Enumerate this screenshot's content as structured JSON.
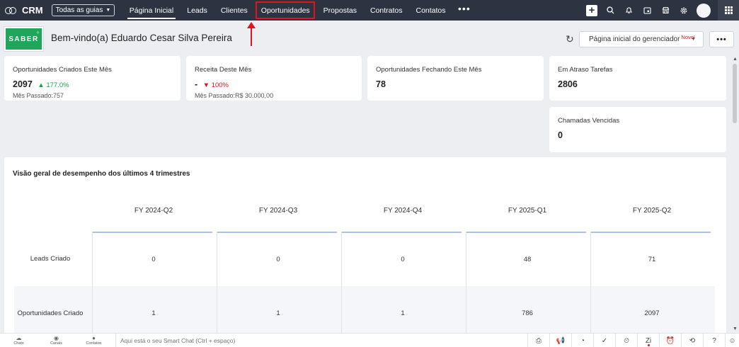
{
  "topbar": {
    "brand": "CRM",
    "scope_label": "Todas as guias",
    "nav": [
      "Página Inicial",
      "Leads",
      "Clientes",
      "Oportunidades",
      "Propostas",
      "Contratos",
      "Contatos"
    ],
    "active_nav": "Página Inicial",
    "highlighted_nav": "Oportunidades",
    "more_label": "•••",
    "icons": [
      "plus-icon",
      "search-icon",
      "bell-icon",
      "calendar-icon",
      "store-icon",
      "gear-icon",
      "avatar",
      "apps-grid-icon"
    ]
  },
  "header": {
    "logo_text": "SABER",
    "welcome": "Bem-vindo(a) Eduardo Cesar Silva Pereira",
    "dashboard_select": "Página inicial do gerenciador",
    "new_badge": "Novo!",
    "more_label": "•••"
  },
  "kpis": [
    {
      "title": "Oportunidades Criados Este Mês",
      "value": "2097",
      "change": "▲ 177.0%",
      "direction": "up",
      "sub": "Mês Passado:757"
    },
    {
      "title": "Receita Deste Mês",
      "value": "-",
      "change": "▼ 100%",
      "direction": "down",
      "sub": "Mês Passado:R$ 30.000,00"
    },
    {
      "title": "Oportunidades Fechando Este Mês",
      "value": "78"
    },
    {
      "title": "Em Atraso Tarefas",
      "value": "2806"
    },
    {
      "title": "Chamadas Vencidas",
      "value": "0"
    }
  ],
  "performance": {
    "title": "Visão geral de desempenho dos últimos 4 trimestres",
    "quarters": [
      "FY 2024-Q2",
      "FY 2024-Q3",
      "FY 2024-Q4",
      "FY 2025-Q1",
      "FY 2025-Q2"
    ],
    "rows": [
      {
        "label": "Leads Criado",
        "values": [
          "0",
          "0",
          "0",
          "48",
          "71"
        ]
      },
      {
        "label": "Oportunidades Criado",
        "values": [
          "1",
          "1",
          "1",
          "786",
          "2097"
        ]
      }
    ]
  },
  "bottombar": {
    "items": [
      "Chats",
      "Canais",
      "Contatos"
    ],
    "smart_chat_placeholder": "Aqui está o seu Smart Chat (Ctrl + espaço)"
  },
  "colors": {
    "topbar": "#2d3340",
    "highlight": "#e0141b",
    "up": "#17a04a",
    "down": "#e0141b",
    "logo": "#1fa65a"
  }
}
